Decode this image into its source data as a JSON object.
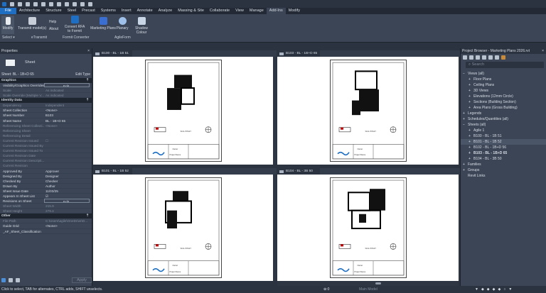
{
  "ribbon_tabs": [
    "File",
    "Architecture",
    "Structure",
    "Steel",
    "Precast",
    "Systems",
    "Insert",
    "Annotate",
    "Analyze",
    "Massing & Site",
    "Collaborate",
    "View",
    "Manage",
    "Add-Ins",
    "Modify"
  ],
  "active_tab": "Add-Ins",
  "ribbon": {
    "modify": "Modify",
    "transmit": "Transmit model(s)",
    "help": "Help",
    "about": "About",
    "convert": "Convert RFA to Formit",
    "marketing": "Marketing Plans",
    "planary": "Planary",
    "shadow": "Shadow Colour",
    "groups": {
      "select": "Select ▾",
      "etransmit": "eTransmit",
      "formit": "Formit Converter",
      "agileform": "AgileForm"
    }
  },
  "properties": {
    "title": "Properties",
    "type": "Sheet",
    "selector": "Sheet: BL - 1B+D 65",
    "edit_type": "Edit Type",
    "apply": "Apply",
    "sections": [
      {
        "name": "Graphics",
        "rows": [
          {
            "k": "Visibility/Graphics Overrides",
            "v": "Edit...",
            "btn": true
          },
          {
            "k": "Scale",
            "v": "As indicated",
            "dim": true
          },
          {
            "k": "Scale Override (Multiple V...",
            "v": "As indicated",
            "dim": true
          }
        ]
      },
      {
        "name": "Identity Data",
        "rows": [
          {
            "k": "Dependency",
            "v": "Independent",
            "dim": true
          },
          {
            "k": "Sheet Collection",
            "v": "<None>"
          },
          {
            "k": "Sheet Number",
            "v": "B103"
          },
          {
            "k": "Sheet Name",
            "v": "BL - 1B+D 65"
          },
          {
            "k": "Referencing Sheet Collecti...",
            "v": "<None>",
            "dim": true
          },
          {
            "k": "Referencing Sheet",
            "v": "",
            "dim": true
          },
          {
            "k": "Referencing Detail",
            "v": "",
            "dim": true
          },
          {
            "k": "Current Revision Issued",
            "v": "☐",
            "dim": true
          },
          {
            "k": "Current Revision Issued By",
            "v": "",
            "dim": true
          },
          {
            "k": "Current Revision Issued To",
            "v": "",
            "dim": true
          },
          {
            "k": "Current Revision Date",
            "v": "",
            "dim": true
          },
          {
            "k": "Current Revision Descripti...",
            "v": "",
            "dim": true
          },
          {
            "k": "Current Revision",
            "v": "",
            "dim": true
          },
          {
            "k": "Approved By",
            "v": "Approver"
          },
          {
            "k": "Designed By",
            "v": "Designer"
          },
          {
            "k": "Checked By",
            "v": "Checker"
          },
          {
            "k": "Drawn By",
            "v": "Author"
          },
          {
            "k": "Sheet Issue Date",
            "v": "11/03/25"
          },
          {
            "k": "Appears In Sheet List",
            "v": "☑"
          },
          {
            "k": "Revisions on Sheet",
            "v": "Edit...",
            "btn": true
          },
          {
            "k": "Sheet Width",
            "v": "215.9",
            "dim": true
          },
          {
            "k": "Sheet Height",
            "v": "279.4",
            "dim": true
          }
        ]
      },
      {
        "name": "Other",
        "rows": [
          {
            "k": "File Path",
            "v": "C:\\Users\\agile\\OneDrive\\D...",
            "dim": true
          },
          {
            "k": "Guide Grid",
            "v": "<None>"
          },
          {
            "k": "_AF_Sheet_Classification",
            "v": ""
          }
        ]
      }
    ]
  },
  "views": [
    {
      "tab": "B100 - BL - 1B 51"
    },
    {
      "tab": "B103 - BL - 1B+D 65"
    },
    {
      "tab": "B101 - BL - 1B 52"
    },
    {
      "tab": "B104 - BL - 3B 50"
    }
  ],
  "titleblock": {
    "owner": "Owner",
    "project": "Project Name",
    "seal": "SEAL/SHEET"
  },
  "browser": {
    "title": "Project Browser - Marketing Plans 2026.rvt",
    "search": "Search",
    "items": [
      {
        "t": "Views (all)",
        "l": 0,
        "e": "−"
      },
      {
        "t": "Floor Plans",
        "l": 1,
        "e": "+"
      },
      {
        "t": "Ceiling Plans",
        "l": 1,
        "e": "+"
      },
      {
        "t": "3D Views",
        "l": 1,
        "e": "+"
      },
      {
        "t": "Elevations (12mm Circle)",
        "l": 1,
        "e": "+"
      },
      {
        "t": "Sections (Building Section)",
        "l": 1,
        "e": "+"
      },
      {
        "t": "Area Plans (Gross Building)",
        "l": 1,
        "e": "+"
      },
      {
        "t": "Legends",
        "l": 0,
        "e": "+"
      },
      {
        "t": "Schedules/Quantities (all)",
        "l": 0,
        "e": "+"
      },
      {
        "t": "Sheets (all)",
        "l": 0,
        "e": "−"
      },
      {
        "t": "Agile 1",
        "l": 1,
        "e": "+"
      },
      {
        "t": "B100 - BL - 1B 51",
        "l": 1,
        "e": "+"
      },
      {
        "t": "B101 - BL - 1B 52",
        "l": 1,
        "e": "+",
        "sel": true
      },
      {
        "t": "B102 - BL - 1B+D 56",
        "l": 1,
        "e": "+"
      },
      {
        "t": "B103 - BL - 1B+D 65",
        "l": 1,
        "e": "+",
        "bold": true
      },
      {
        "t": "B104 - BL - 3B 50",
        "l": 1,
        "e": "+"
      },
      {
        "t": "Families",
        "l": 0,
        "e": "+"
      },
      {
        "t": "Groups",
        "l": 0,
        "e": "+"
      },
      {
        "t": "Revit Links",
        "l": 0,
        "e": ""
      }
    ]
  },
  "status": {
    "text": "Click to select, TAB for alternates, CTRL adds, SHIFT unselects.",
    "model": "Main Model",
    "zero": ":0"
  },
  "colors": {
    "accent": "#1e6fc3",
    "panel": "#3b4556"
  }
}
